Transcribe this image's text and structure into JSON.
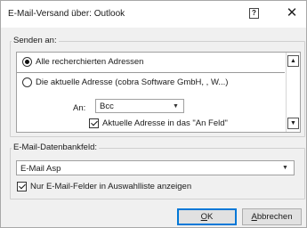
{
  "window": {
    "title": "E-Mail-Versand über: Outlook",
    "help_icon": "?",
    "close_icon": "✕"
  },
  "send_to": {
    "group_label": "Senden an:",
    "options": [
      {
        "label": "Alle recherchierten Adressen",
        "checked": true
      },
      {
        "label": "Die aktuelle Adresse (cobra Software GmbH,  , W...)",
        "checked": false
      }
    ],
    "an_label": "An:",
    "an_value": "Bcc",
    "current_address_checkbox": "Aktuelle Adresse in das \"An Feld\"",
    "current_address_checked": true,
    "scroll_up_icon": "▲",
    "scroll_down_icon": "▼"
  },
  "db_field": {
    "group_label": "E-Mail-Datenbankfeld:",
    "value": "E-Mail Asp",
    "only_email_checkbox": "Nur E-Mail-Felder in Auswahlliste anzeigen",
    "only_email_checked": true
  },
  "buttons": {
    "ok_mnemonic": "O",
    "ok_rest": "K",
    "cancel_mnemonic": "A",
    "cancel_rest": "bbrechen"
  },
  "icons": {
    "dropdown": "▼"
  }
}
